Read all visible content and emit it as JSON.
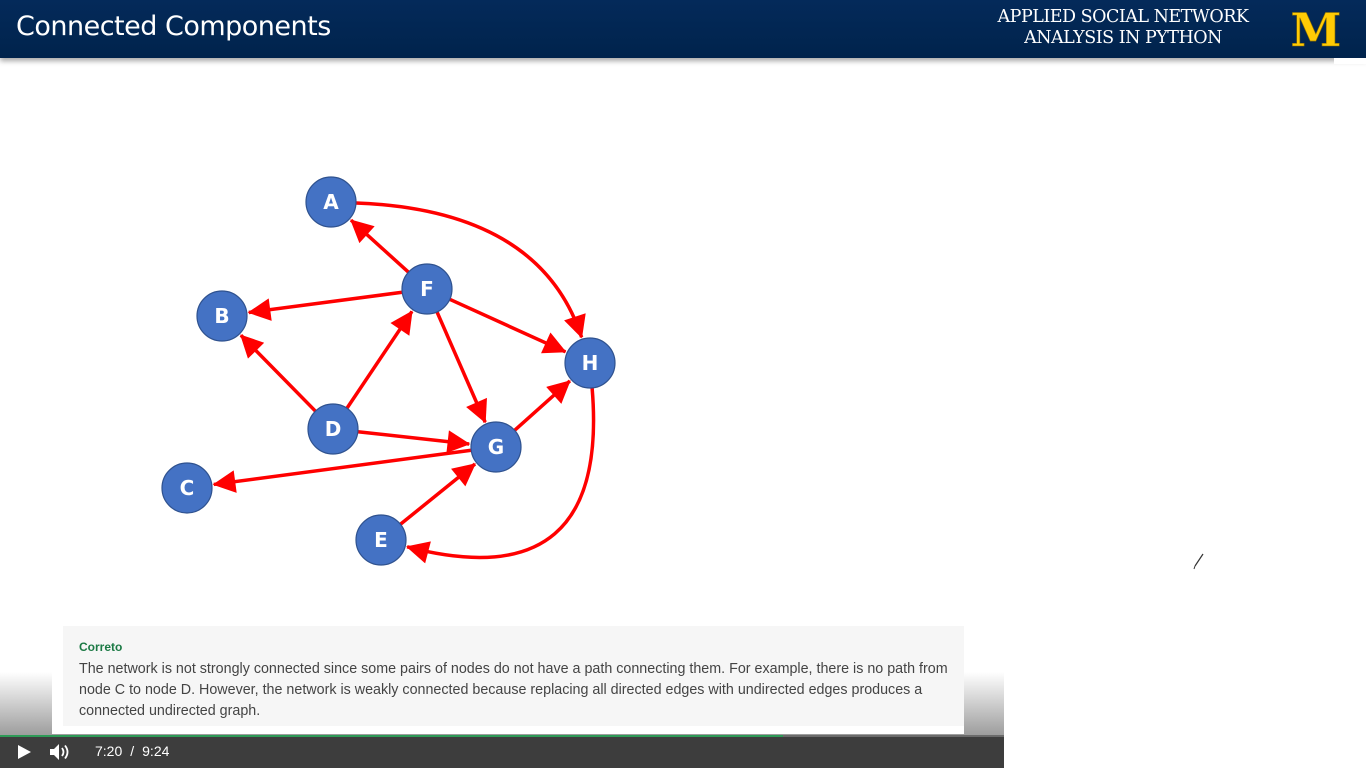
{
  "slide": {
    "title": "Connected Components",
    "course_line1": "APPLIED SOCIAL NETWORK",
    "course_line2": "ANALYSIS IN PYTHON",
    "logo_letter": "M",
    "logo_color": "#ffcb05",
    "header_color": "#00234c"
  },
  "graph": {
    "node_color": "#4472c4",
    "edge_color": "#ff0000",
    "nodes": [
      {
        "id": "A",
        "label": "A"
      },
      {
        "id": "B",
        "label": "B"
      },
      {
        "id": "C",
        "label": "C"
      },
      {
        "id": "D",
        "label": "D"
      },
      {
        "id": "E",
        "label": "E"
      },
      {
        "id": "F",
        "label": "F"
      },
      {
        "id": "G",
        "label": "G"
      },
      {
        "id": "H",
        "label": "H"
      }
    ],
    "edges": [
      {
        "from": "A",
        "to": "H"
      },
      {
        "from": "F",
        "to": "A"
      },
      {
        "from": "F",
        "to": "B"
      },
      {
        "from": "F",
        "to": "H"
      },
      {
        "from": "F",
        "to": "G"
      },
      {
        "from": "D",
        "to": "B"
      },
      {
        "from": "D",
        "to": "F"
      },
      {
        "from": "D",
        "to": "G"
      },
      {
        "from": "G",
        "to": "H"
      },
      {
        "from": "G",
        "to": "C"
      },
      {
        "from": "E",
        "to": "G"
      },
      {
        "from": "H",
        "to": "E"
      }
    ]
  },
  "feedback": {
    "status": "Correto",
    "status_color": "#1c7a45",
    "text": "The network is not strongly connected since some pairs of nodes do not have a path connecting them. For example, there is no path from node C to node D. However, the network is weakly connected because replacing all directed edges with undirected edges produces a connected undirected graph."
  },
  "player": {
    "current_time": "7:20",
    "separator": "/",
    "duration": "9:24",
    "progress_fraction": 0.78,
    "play_icon": "play-icon",
    "volume_icon": "volume-icon"
  }
}
